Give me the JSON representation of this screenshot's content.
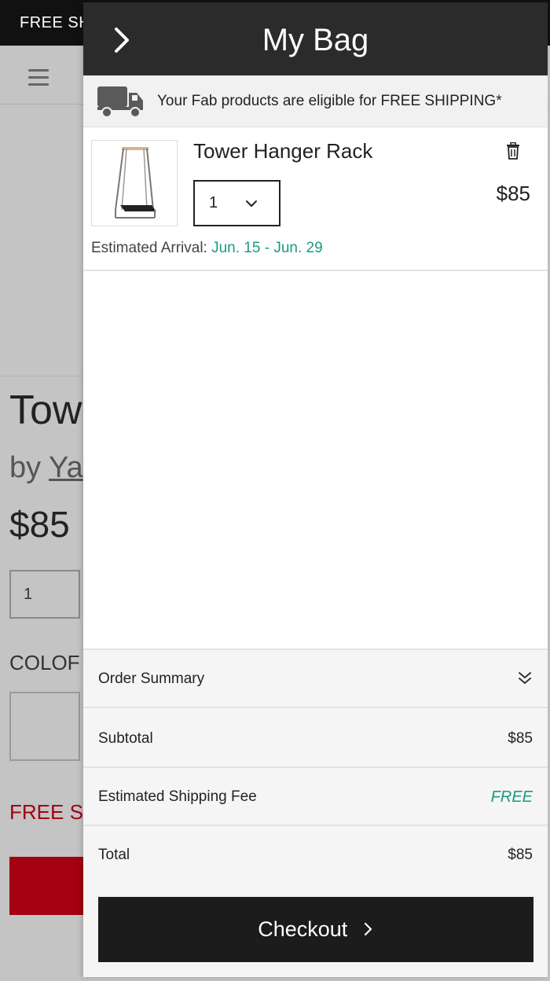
{
  "background_page": {
    "banner_text": "FREE SH",
    "title_partial": "Tow",
    "by_label": "by",
    "brand_partial": "Ya",
    "price": "$85",
    "qty_value": "1",
    "color_label": "COLOF",
    "free_shipping_partial": "FREE SH"
  },
  "drawer": {
    "title": "My Bag",
    "shipping_notice": "Your Fab products are eligible for FREE SHIPPING*",
    "items": [
      {
        "name": "Tower Hanger Rack",
        "quantity": "1",
        "price": "$85",
        "arrival_label": "Estimated Arrival:",
        "arrival_dates": "Jun. 15 - Jun. 29"
      }
    ],
    "summary": {
      "header": "Order Summary",
      "subtotal_label": "Subtotal",
      "subtotal_value": "$85",
      "shipping_label": "Estimated Shipping Fee",
      "shipping_value": "FREE",
      "total_label": "Total",
      "total_value": "$85"
    },
    "checkout_label": "Checkout"
  },
  "colors": {
    "accent_green": "#1a9a7d",
    "header_dark": "#2b2b2b",
    "brand_red": "#a30012"
  }
}
